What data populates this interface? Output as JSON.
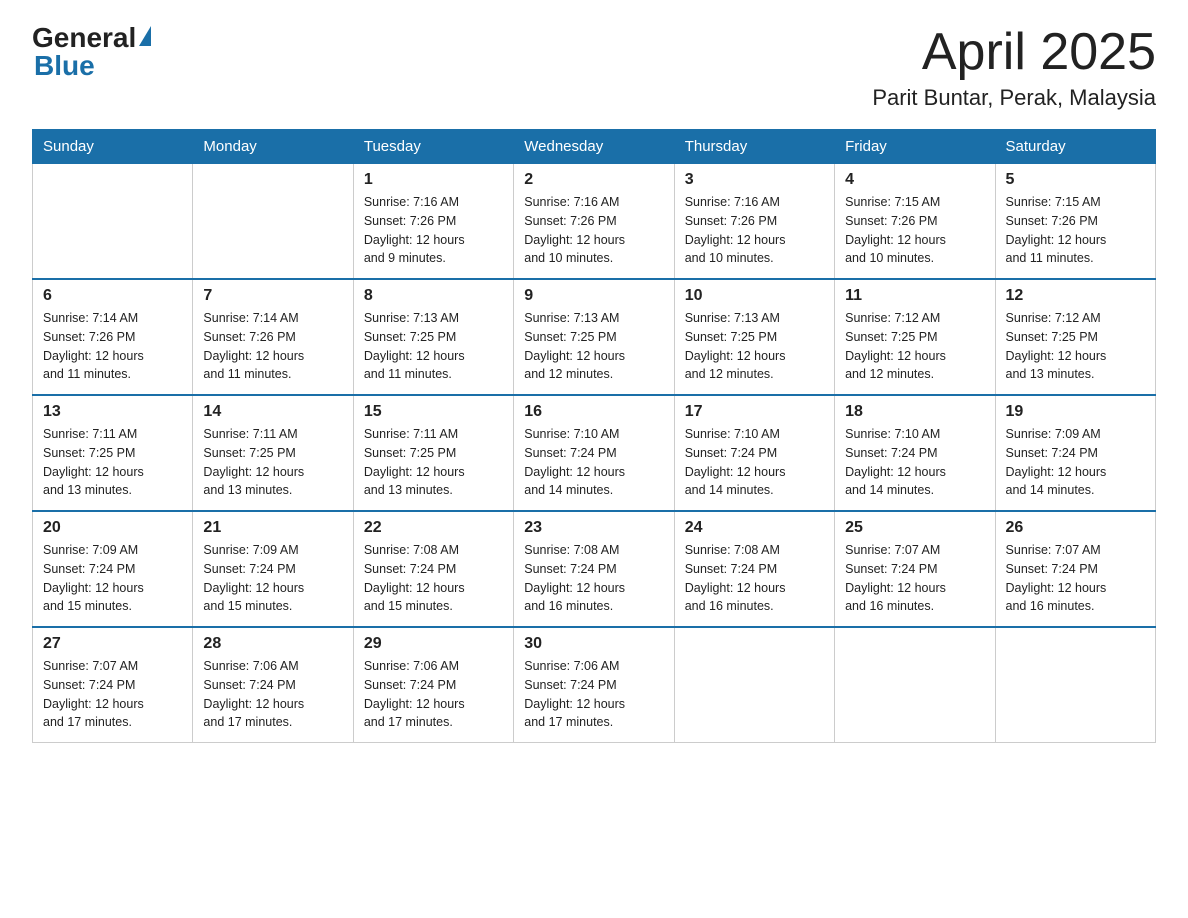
{
  "header": {
    "logo_general": "General",
    "logo_blue": "Blue",
    "main_title": "April 2025",
    "subtitle": "Parit Buntar, Perak, Malaysia"
  },
  "weekdays": [
    "Sunday",
    "Monday",
    "Tuesday",
    "Wednesday",
    "Thursday",
    "Friday",
    "Saturday"
  ],
  "weeks": [
    [
      {
        "day": "",
        "info": ""
      },
      {
        "day": "",
        "info": ""
      },
      {
        "day": "1",
        "info": "Sunrise: 7:16 AM\nSunset: 7:26 PM\nDaylight: 12 hours\nand 9 minutes."
      },
      {
        "day": "2",
        "info": "Sunrise: 7:16 AM\nSunset: 7:26 PM\nDaylight: 12 hours\nand 10 minutes."
      },
      {
        "day": "3",
        "info": "Sunrise: 7:16 AM\nSunset: 7:26 PM\nDaylight: 12 hours\nand 10 minutes."
      },
      {
        "day": "4",
        "info": "Sunrise: 7:15 AM\nSunset: 7:26 PM\nDaylight: 12 hours\nand 10 minutes."
      },
      {
        "day": "5",
        "info": "Sunrise: 7:15 AM\nSunset: 7:26 PM\nDaylight: 12 hours\nand 11 minutes."
      }
    ],
    [
      {
        "day": "6",
        "info": "Sunrise: 7:14 AM\nSunset: 7:26 PM\nDaylight: 12 hours\nand 11 minutes."
      },
      {
        "day": "7",
        "info": "Sunrise: 7:14 AM\nSunset: 7:26 PM\nDaylight: 12 hours\nand 11 minutes."
      },
      {
        "day": "8",
        "info": "Sunrise: 7:13 AM\nSunset: 7:25 PM\nDaylight: 12 hours\nand 11 minutes."
      },
      {
        "day": "9",
        "info": "Sunrise: 7:13 AM\nSunset: 7:25 PM\nDaylight: 12 hours\nand 12 minutes."
      },
      {
        "day": "10",
        "info": "Sunrise: 7:13 AM\nSunset: 7:25 PM\nDaylight: 12 hours\nand 12 minutes."
      },
      {
        "day": "11",
        "info": "Sunrise: 7:12 AM\nSunset: 7:25 PM\nDaylight: 12 hours\nand 12 minutes."
      },
      {
        "day": "12",
        "info": "Sunrise: 7:12 AM\nSunset: 7:25 PM\nDaylight: 12 hours\nand 13 minutes."
      }
    ],
    [
      {
        "day": "13",
        "info": "Sunrise: 7:11 AM\nSunset: 7:25 PM\nDaylight: 12 hours\nand 13 minutes."
      },
      {
        "day": "14",
        "info": "Sunrise: 7:11 AM\nSunset: 7:25 PM\nDaylight: 12 hours\nand 13 minutes."
      },
      {
        "day": "15",
        "info": "Sunrise: 7:11 AM\nSunset: 7:25 PM\nDaylight: 12 hours\nand 13 minutes."
      },
      {
        "day": "16",
        "info": "Sunrise: 7:10 AM\nSunset: 7:24 PM\nDaylight: 12 hours\nand 14 minutes."
      },
      {
        "day": "17",
        "info": "Sunrise: 7:10 AM\nSunset: 7:24 PM\nDaylight: 12 hours\nand 14 minutes."
      },
      {
        "day": "18",
        "info": "Sunrise: 7:10 AM\nSunset: 7:24 PM\nDaylight: 12 hours\nand 14 minutes."
      },
      {
        "day": "19",
        "info": "Sunrise: 7:09 AM\nSunset: 7:24 PM\nDaylight: 12 hours\nand 14 minutes."
      }
    ],
    [
      {
        "day": "20",
        "info": "Sunrise: 7:09 AM\nSunset: 7:24 PM\nDaylight: 12 hours\nand 15 minutes."
      },
      {
        "day": "21",
        "info": "Sunrise: 7:09 AM\nSunset: 7:24 PM\nDaylight: 12 hours\nand 15 minutes."
      },
      {
        "day": "22",
        "info": "Sunrise: 7:08 AM\nSunset: 7:24 PM\nDaylight: 12 hours\nand 15 minutes."
      },
      {
        "day": "23",
        "info": "Sunrise: 7:08 AM\nSunset: 7:24 PM\nDaylight: 12 hours\nand 16 minutes."
      },
      {
        "day": "24",
        "info": "Sunrise: 7:08 AM\nSunset: 7:24 PM\nDaylight: 12 hours\nand 16 minutes."
      },
      {
        "day": "25",
        "info": "Sunrise: 7:07 AM\nSunset: 7:24 PM\nDaylight: 12 hours\nand 16 minutes."
      },
      {
        "day": "26",
        "info": "Sunrise: 7:07 AM\nSunset: 7:24 PM\nDaylight: 12 hours\nand 16 minutes."
      }
    ],
    [
      {
        "day": "27",
        "info": "Sunrise: 7:07 AM\nSunset: 7:24 PM\nDaylight: 12 hours\nand 17 minutes."
      },
      {
        "day": "28",
        "info": "Sunrise: 7:06 AM\nSunset: 7:24 PM\nDaylight: 12 hours\nand 17 minutes."
      },
      {
        "day": "29",
        "info": "Sunrise: 7:06 AM\nSunset: 7:24 PM\nDaylight: 12 hours\nand 17 minutes."
      },
      {
        "day": "30",
        "info": "Sunrise: 7:06 AM\nSunset: 7:24 PM\nDaylight: 12 hours\nand 17 minutes."
      },
      {
        "day": "",
        "info": ""
      },
      {
        "day": "",
        "info": ""
      },
      {
        "day": "",
        "info": ""
      }
    ]
  ]
}
